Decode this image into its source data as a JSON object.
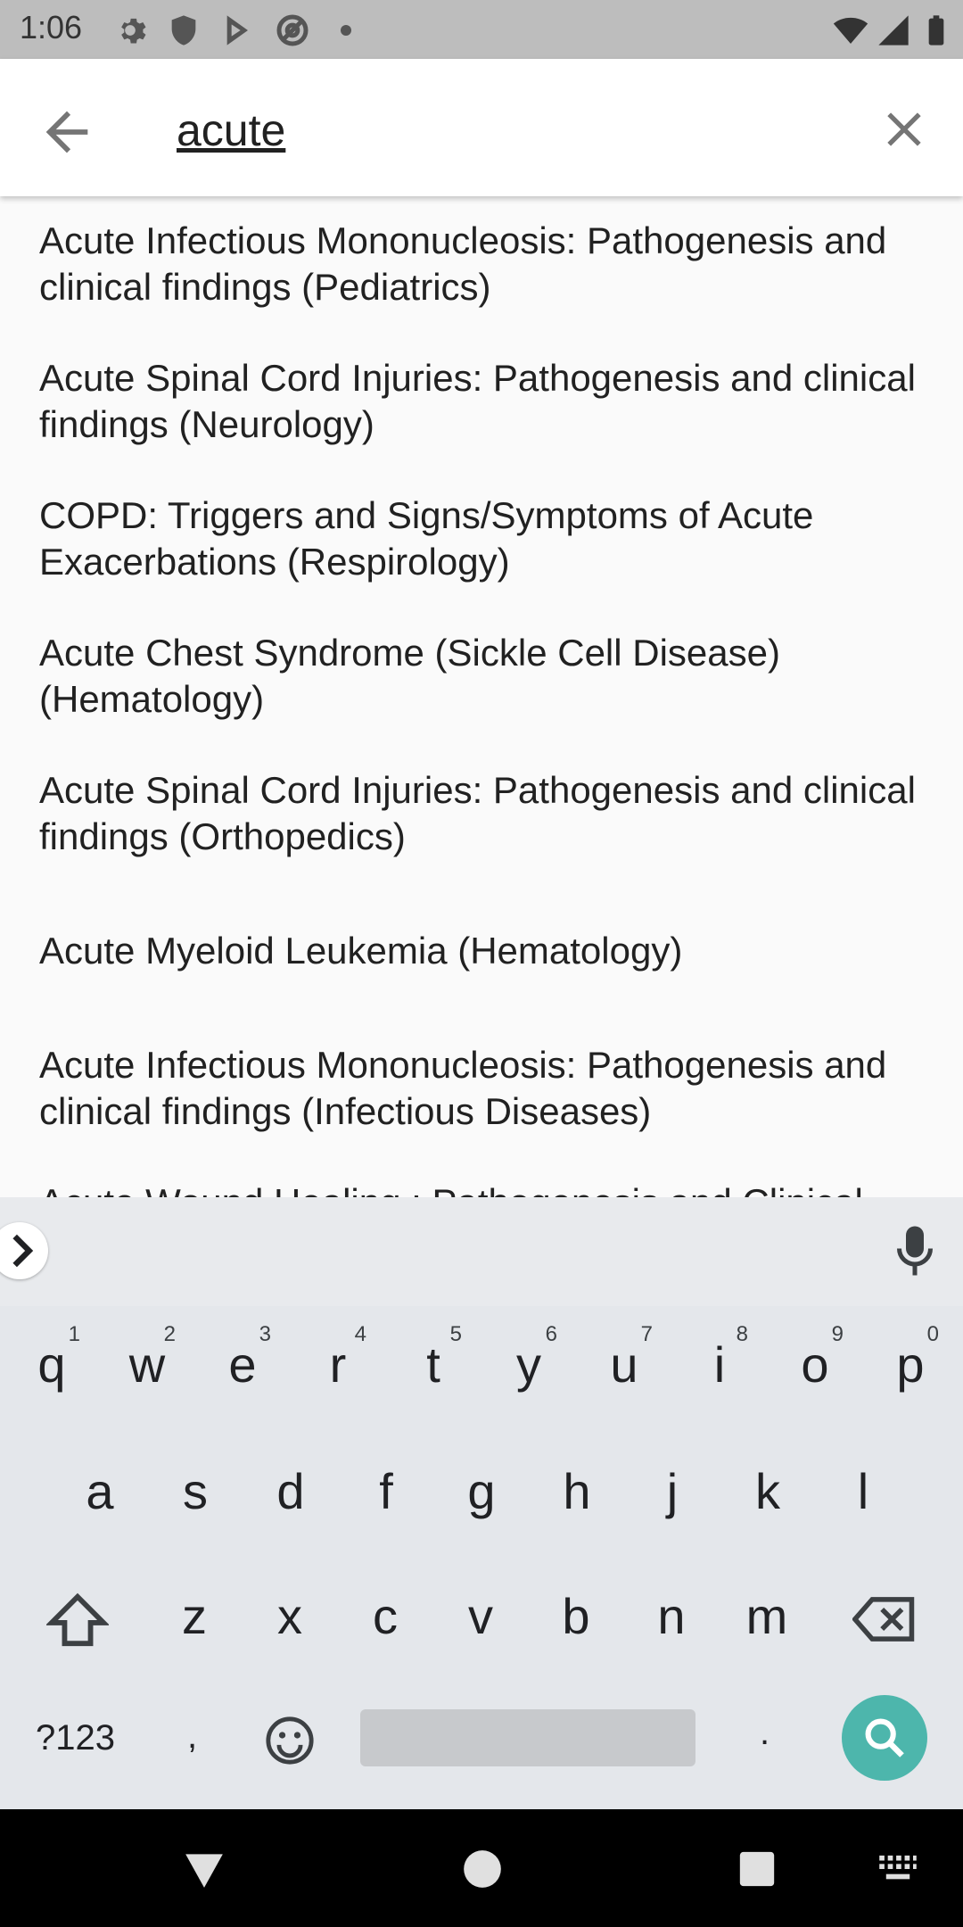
{
  "status_bar": {
    "time": "1:06",
    "left_icons": [
      "gear-icon",
      "shield-icon",
      "play-store-icon",
      "at-sign-icon",
      "dot-icon"
    ],
    "right_icons": [
      "wifi-icon",
      "cell-signal-icon",
      "battery-icon"
    ]
  },
  "search": {
    "query": "acute",
    "back_icon": "arrow-back-icon",
    "clear_icon": "close-icon"
  },
  "results": [
    "Acute Infectious Mononucleosis: Pathogenesis and clinical findings (Pediatrics)",
    "Acute Spinal Cord Injuries: Pathogenesis and clinical findings (Neurology)",
    "COPD: Triggers and Signs/Symptoms of Acute Exacerbations (Respirology)",
    "Acute Chest Syndrome (Sickle Cell Disease) (Hematology)",
    "Acute Spinal Cord Injuries: Pathogenesis and clinical findings (Orthopedics)",
    "Acute Myeloid Leukemia (Hematology)",
    "Acute Infectious Mononucleosis: Pathogenesis and clinical findings (Infectious Diseases)",
    "Acute Wound Healing : Pathogenesis and Clinical"
  ],
  "keyboard": {
    "row1": [
      "q",
      "w",
      "e",
      "r",
      "t",
      "y",
      "u",
      "i",
      "o",
      "p"
    ],
    "row1_hints": [
      "1",
      "2",
      "3",
      "4",
      "5",
      "6",
      "7",
      "8",
      "9",
      "0"
    ],
    "row2": [
      "a",
      "s",
      "d",
      "f",
      "g",
      "h",
      "j",
      "k",
      "l"
    ],
    "row3": [
      "z",
      "x",
      "c",
      "v",
      "b",
      "n",
      "m"
    ],
    "symbols_label": "?123",
    "comma": ",",
    "period": ".",
    "icons": [
      "chevron-right-icon",
      "mic-icon",
      "shift-icon",
      "backspace-icon",
      "emoji-icon",
      "search-icon"
    ]
  },
  "nav_bar": {
    "icons": [
      "back-triangle-icon",
      "home-circle-icon",
      "recents-square-icon",
      "keyboard-switch-icon"
    ]
  },
  "colors": {
    "status_bar_bg": "#bdbdbd",
    "app_bar_bg": "#ffffff",
    "list_bg": "#fafafa",
    "keyboard_bg": "#e8eaed",
    "search_fab": "#4db6ac",
    "nav_bar_bg": "#000000"
  }
}
